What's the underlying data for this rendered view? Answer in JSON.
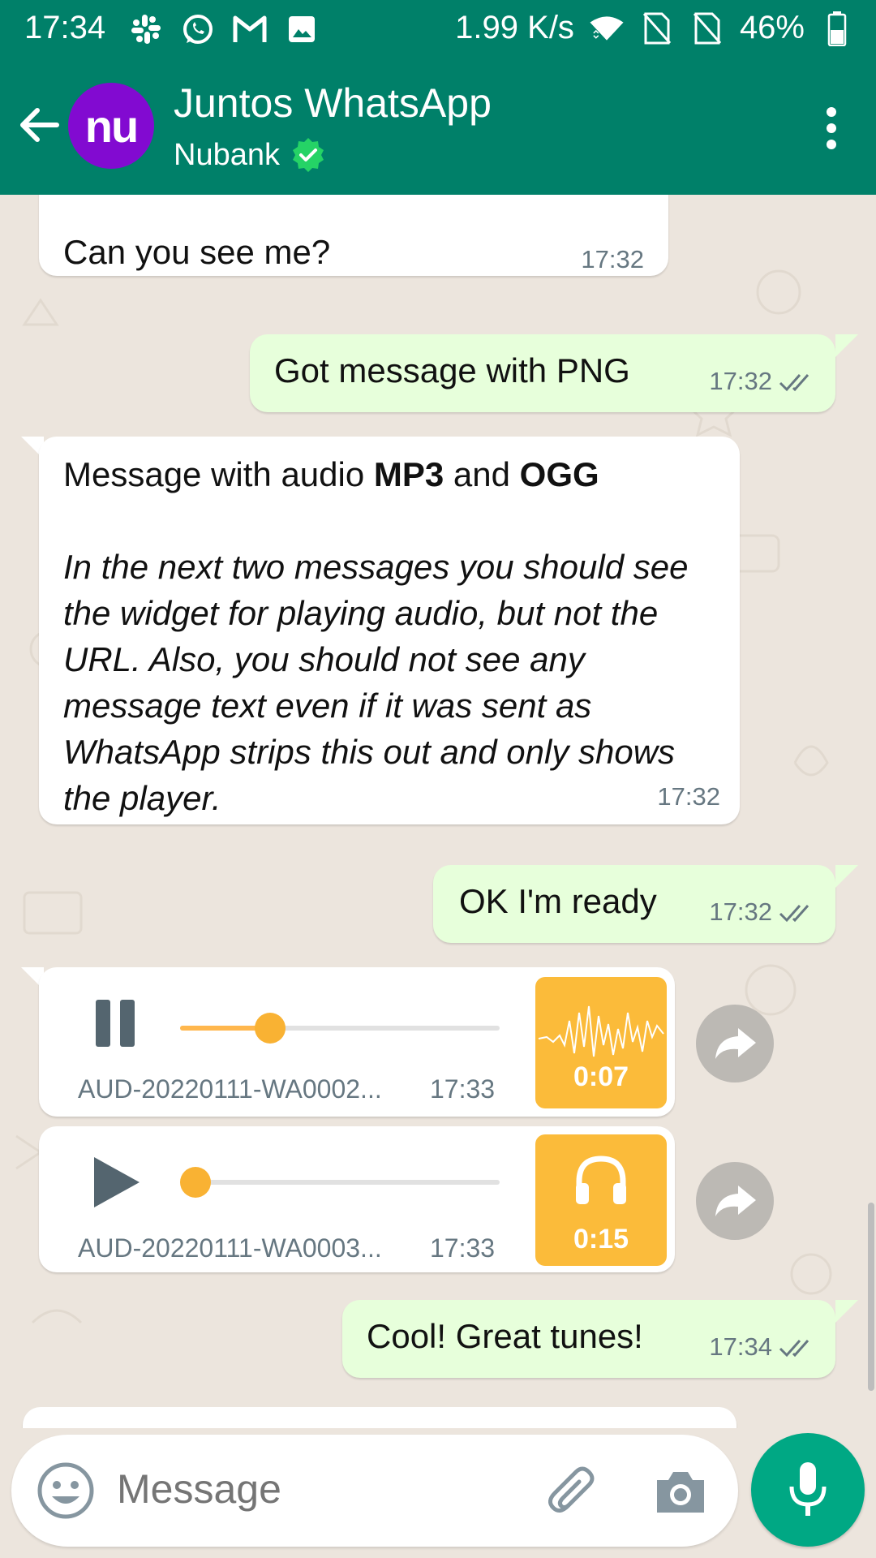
{
  "status_bar": {
    "time": "17:34",
    "speed": "1.99 K/s",
    "battery": "46%",
    "icons": [
      "slack-icon",
      "whatsapp-icon",
      "gmail-icon",
      "image-icon",
      "data-arrows-icon",
      "wifi-icon",
      "no-sim-icon",
      "no-sim-icon",
      "battery-icon"
    ]
  },
  "header": {
    "title": "Juntos WhatsApp",
    "subtitle": "Nubank",
    "avatar_text": "nu",
    "verified": true,
    "colors": {
      "bar": "#008069",
      "avatar": "#820ad1",
      "verified": "#25d366"
    }
  },
  "messages": [
    {
      "dir": "in",
      "text": "Can you see me?",
      "time": "17:32"
    },
    {
      "dir": "out",
      "text": "Got message with PNG",
      "time": "17:32",
      "status": "read"
    },
    {
      "dir": "in",
      "line1_a": "Message with audio ",
      "line1_b": "MP3",
      "line1_c": " and ",
      "line1_d": "OGG",
      "italic": "In the next two messages you should see the widget for playing audio, but not the URL. Also, you should not see any message text even if it was sent as WhatsApp strips this out and only shows the player.",
      "time": "17:32"
    },
    {
      "dir": "out",
      "text": "OK I'm ready",
      "time": "17:32",
      "status": "read"
    },
    {
      "dir": "in",
      "type": "audio",
      "filename": "AUD-20220111-WA0002...",
      "time": "17:33",
      "duration": "0:07",
      "state": "playing",
      "progress": 0.28,
      "thumb": "waveform"
    },
    {
      "dir": "in",
      "type": "audio",
      "filename": "AUD-20220111-WA0003...",
      "time": "17:33",
      "duration": "0:15",
      "state": "paused",
      "progress": 0.0,
      "thumb": "headphones"
    },
    {
      "dir": "out",
      "text": "Cool! Great tunes!",
      "time": "17:34",
      "status": "read"
    }
  ],
  "composer": {
    "placeholder": "Message"
  }
}
